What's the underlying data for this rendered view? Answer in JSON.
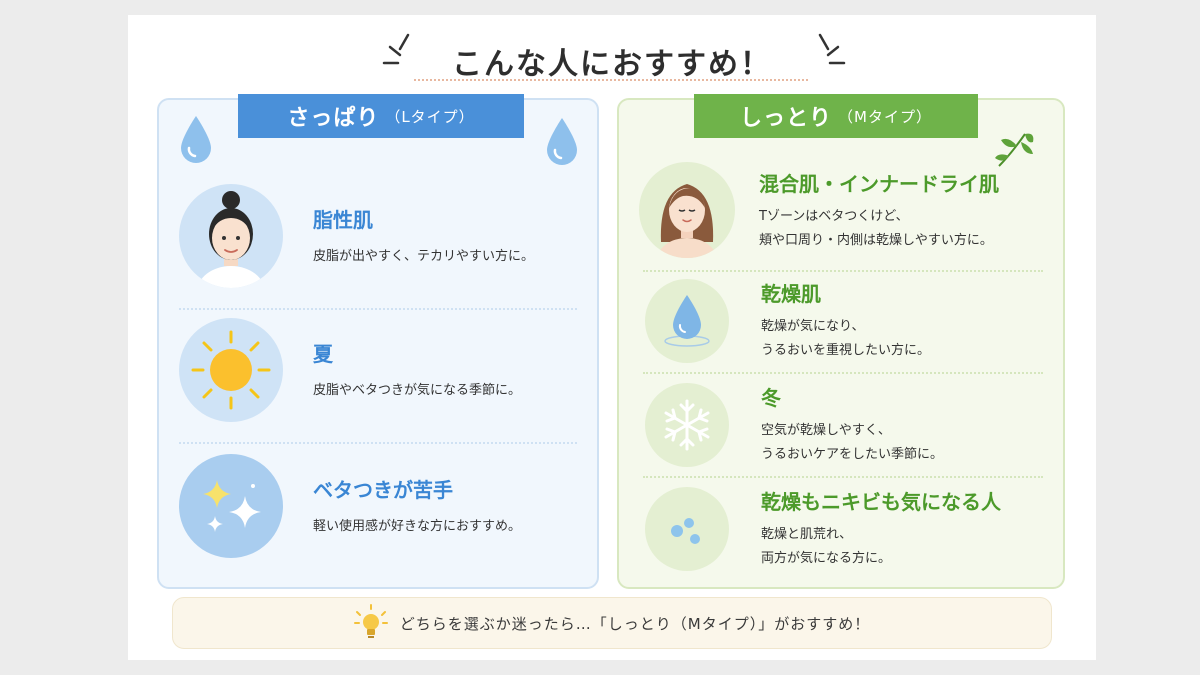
{
  "title": "こんな人におすすめ！",
  "left": {
    "ribbon_main": "さっぱり",
    "ribbon_sub": "（Lタイプ）",
    "items": [
      {
        "heading": "脂性肌",
        "desc": [
          "皮脂が出やすく、テカリやすい方に。"
        ],
        "icon": "woman-face-icon"
      },
      {
        "heading": "夏",
        "desc": [
          "皮脂やベタつきが気になる季節に。"
        ],
        "icon": "sun-icon"
      },
      {
        "heading": "ベタつきが苦手",
        "desc": [
          "軽い使用感が好きな方におすすめ。"
        ],
        "icon": "sparkle-icon"
      }
    ]
  },
  "right": {
    "ribbon_main": "しっとり",
    "ribbon_sub": "（Mタイプ）",
    "items": [
      {
        "heading": "混合肌・インナードライ肌",
        "desc": [
          "Tゾーンはベタつくけど、",
          "頬や口周り・内側は乾燥しやすい方に。"
        ],
        "icon": "woman-face-icon"
      },
      {
        "heading": "乾燥肌",
        "desc": [
          "乾燥が気になり、",
          "うるおいを重視したい方に。"
        ],
        "icon": "water-drop-icon"
      },
      {
        "heading": "冬",
        "desc": [
          "空気が乾燥しやすく、",
          "うるおいケアをしたい季節に。"
        ],
        "icon": "snowflake-icon"
      },
      {
        "heading": "乾燥もニキビも気になる人",
        "desc": [
          "乾燥と肌荒れ、",
          "両方が気になる方に。"
        ],
        "icon": "bubbles-icon"
      }
    ]
  },
  "tip": "どちらを選ぶか迷ったら…「しっとり（Mタイプ）」がおすすめ！",
  "colors": {
    "left_accent": "#3a86d4",
    "right_accent": "#4c9a2a",
    "left_ribbon": "#4a90d9",
    "right_ribbon": "#6fb34a"
  }
}
